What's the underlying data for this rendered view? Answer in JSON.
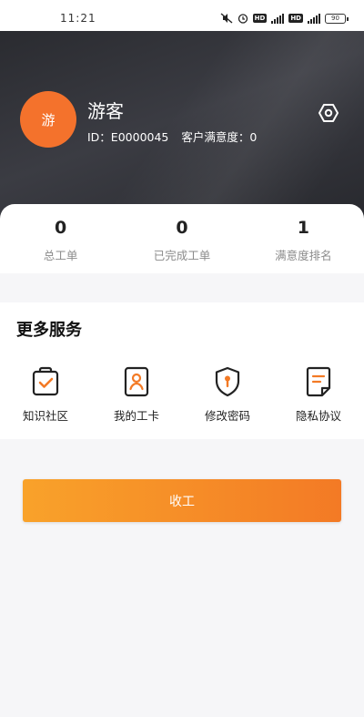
{
  "status_bar": {
    "time": "11:21",
    "hd1": "HD",
    "hd2": "HD",
    "battery": "90"
  },
  "profile": {
    "avatar_text": "游",
    "name": "游客",
    "id_text": "ID：E0000045",
    "satisfaction_text": "客户满意度：0"
  },
  "stats": [
    {
      "value": "0",
      "label": "总工单"
    },
    {
      "value": "0",
      "label": "已完成工单"
    },
    {
      "value": "1",
      "label": "满意度排名"
    }
  ],
  "services": {
    "title": "更多服务",
    "items": [
      {
        "label": "知识社区",
        "icon": "bag-check-icon"
      },
      {
        "label": "我的工卡",
        "icon": "badge-icon"
      },
      {
        "label": "修改密码",
        "icon": "shield-key-icon"
      },
      {
        "label": "隐私协议",
        "icon": "document-icon"
      }
    ]
  },
  "actions": {
    "logout_label": "收工"
  },
  "colors": {
    "accent": "#f37a25",
    "accent_light": "#f9a22a",
    "header_dark": "#2f3035"
  }
}
